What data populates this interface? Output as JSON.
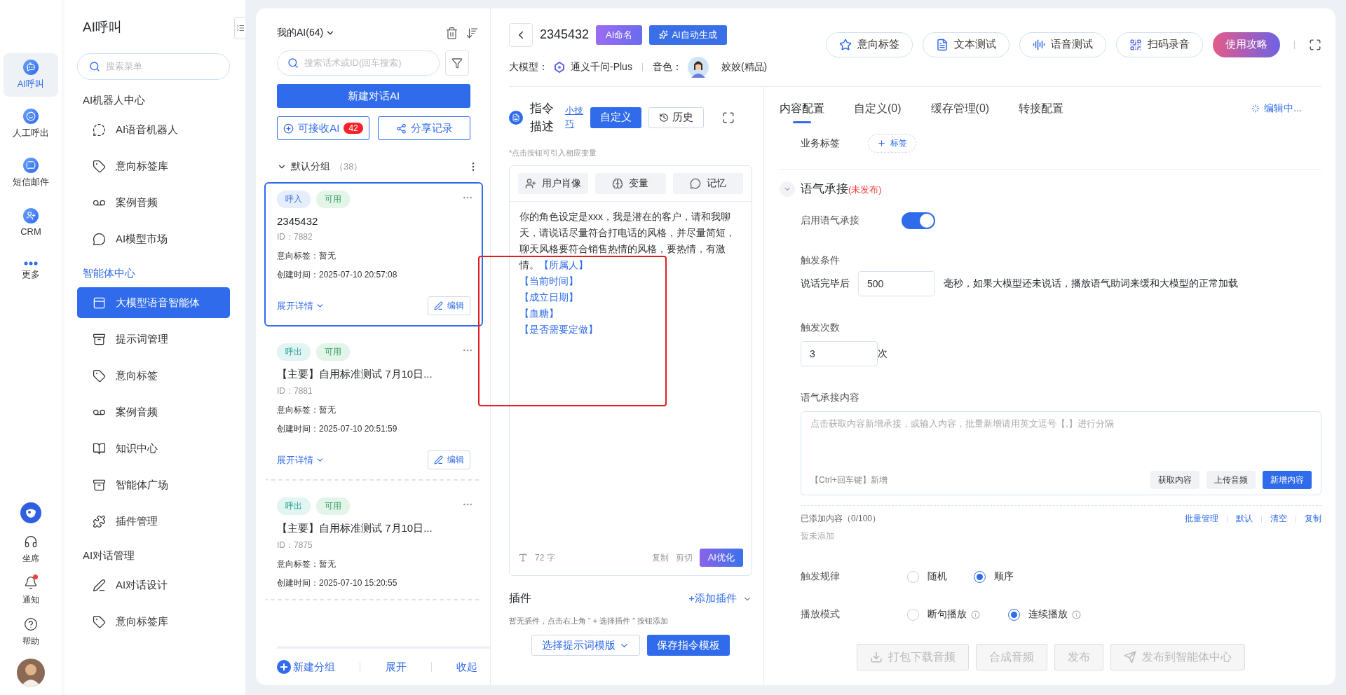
{
  "rail": {
    "items": [
      {
        "label": "AI呼叫",
        "selected": true
      },
      {
        "label": "人工呼出",
        "selected": false
      },
      {
        "label": "短信邮件",
        "selected": false
      },
      {
        "label": "CRM",
        "selected": false
      },
      {
        "label": "更多",
        "selected": false
      }
    ],
    "bottom": [
      {
        "label": "坐席",
        "dot": false
      },
      {
        "label": "通知",
        "dot": true
      },
      {
        "label": "帮助",
        "dot": false
      }
    ]
  },
  "menu": {
    "title": "AI呼叫",
    "search": {
      "placeholder": "搜索菜单"
    },
    "sections": [
      {
        "heading": "AI机器人中心",
        "active": false,
        "items": [
          {
            "label": "AI语音机器人",
            "selected": false
          },
          {
            "label": "意向标签库",
            "selected": false
          },
          {
            "label": "案例音频",
            "selected": false
          },
          {
            "label": "AI模型市场",
            "selected": false
          }
        ]
      },
      {
        "heading": "智能体中心",
        "active": true,
        "items": [
          {
            "label": "大模型语音智能体",
            "selected": true
          },
          {
            "label": "提示词管理",
            "selected": false
          },
          {
            "label": "意向标签",
            "selected": false
          },
          {
            "label": "案例音频",
            "selected": false
          },
          {
            "label": "知识中心",
            "selected": false
          },
          {
            "label": "智能体广场",
            "selected": false
          },
          {
            "label": "插件管理",
            "selected": false
          }
        ]
      },
      {
        "heading": "AI对话管理",
        "active": false,
        "items": [
          {
            "label": "AI对话设计",
            "selected": false
          },
          {
            "label": "意向标签库",
            "selected": false
          }
        ]
      }
    ]
  },
  "list": {
    "title": "我的AI(64)",
    "search": {
      "placeholder": "搜索话术或ID(回车搜索)"
    },
    "new_button": "新建对话AI",
    "receive_button": {
      "label": "可接收AI",
      "badge": "42"
    },
    "share_button": "分享记录",
    "group": {
      "name": "默认分组",
      "count": "（38）",
      "expanded": true
    },
    "cards": [
      {
        "selected": true,
        "tags": [
          {
            "text": "呼入",
            "kind": "inbound"
          },
          {
            "text": "可用",
            "kind": "available"
          }
        ],
        "title": "2345432",
        "id": "ID：7882",
        "intent": "意向标签：暂无",
        "created": "创建时间：2025-07-10 20:57:08",
        "expand": "展开详情",
        "edit": "编辑"
      },
      {
        "selected": false,
        "tags": [
          {
            "text": "呼出",
            "kind": "outbound"
          },
          {
            "text": "可用",
            "kind": "available"
          }
        ],
        "title": "【主要】自用标准测试 7月10日...",
        "id": "ID：7881",
        "intent": "意向标签：暂无",
        "created": "创建时间：2025-07-10 20:51:59",
        "expand": "展开详情",
        "edit": "编辑"
      },
      {
        "selected": false,
        "tags": [
          {
            "text": "呼出",
            "kind": "outbound"
          },
          {
            "text": "可用",
            "kind": "available"
          }
        ],
        "title": "【主要】自用标准测试 7月10日...",
        "id": "ID：7875",
        "intent": "意向标签：暂无",
        "created": "创建时间：2025-07-10 15:20:55"
      }
    ],
    "footer": [
      "新建分组",
      "展开",
      "收起"
    ]
  },
  "header": {
    "title": "2345432",
    "name_button": "AI命名",
    "generate_button": "AI自动生成",
    "model_label": "大模型：",
    "model": "通义千问-Plus",
    "voice_label": "音色：",
    "voice": "姣姣(精品)",
    "actions": [
      "意向标签",
      "文本测试",
      "语音测试",
      "扫码录音"
    ],
    "guide_button": "使用攻略"
  },
  "instruction": {
    "title": "指令描述",
    "tips_link": "小技巧",
    "custom_button": "自定义",
    "history_button": "历史",
    "hint": "*点击按钮可引入相应变量",
    "tools": [
      "用户肖像",
      "变量",
      "记忆"
    ],
    "lines": [
      [
        {
          "kind": "plain",
          "text": "你的角色设定是xxx，我是潜在的客户，请和我聊天，请说话尽量符合打电话的风格，并尽量简短，聊天风格要符合销售热情的风格，要热情，有激情。"
        },
        {
          "kind": "variable",
          "text": "【所属人】"
        }
      ],
      [
        {
          "kind": "variable",
          "text": "【当前时间】"
        }
      ],
      [
        {
          "kind": "variable",
          "text": "【成立日期】"
        }
      ],
      [
        {
          "kind": "variable",
          "text": "【血糖】"
        }
      ],
      [
        {
          "kind": "variable",
          "text": "【是否需要定做】"
        }
      ]
    ],
    "char_count": "72 字",
    "copy": "复制",
    "cut": "剪切",
    "optimize_button": "AI优化"
  },
  "plugins": {
    "title": "插件",
    "add_link": "+添加插件",
    "hint": "暂无插件，点击右上角 “ + 选择插件 ” 按钮添加",
    "template_select": "选择提示词模版",
    "save_button": "保存指令模板"
  },
  "annotation": {
    "kind": "frame"
  },
  "tabs": [
    {
      "label": "内容配置",
      "selected": true
    },
    {
      "label": "自定义(0)",
      "selected": false
    },
    {
      "label": "缓存管理(0)",
      "selected": false
    },
    {
      "label": "转接配置",
      "selected": false
    }
  ],
  "edit_status": "编辑中...",
  "business_tag": {
    "label": "业务标签",
    "add": "标签"
  },
  "section": {
    "title": "语气承接",
    "status": "(未发布)",
    "expanded": true,
    "enable": {
      "label": "启用语气承接",
      "on": true
    },
    "trigger": {
      "label": "触发条件",
      "before": "说话完毕后",
      "value": "500",
      "after": "毫秒，如果大模型还未说话，播放语气助词来缓和大模型的正常加载"
    },
    "count": {
      "label": "触发次数",
      "value": "3",
      "unit": "次"
    },
    "content": {
      "label": "语气承接内容",
      "placeholder": "点击获取内容新增承接，或输入内容，批量新增请用英文逗号【,】进行分隔",
      "shortcut": "【Ctrl+回车键】新增",
      "buttons": [
        {
          "label": "获取内容",
          "primary": false
        },
        {
          "label": "上传音频",
          "primary": false
        },
        {
          "label": "新增内容",
          "primary": true
        }
      ]
    },
    "added": {
      "label": "已添加内容（0/100）",
      "links": [
        "批量管理",
        "默认",
        "清空",
        "复制"
      ],
      "empty": "暂未添加"
    },
    "rule": {
      "label": "触发规律",
      "options": [
        {
          "label": "随机",
          "selected": false,
          "info": false
        },
        {
          "label": "顺序",
          "selected": true,
          "info": false
        }
      ]
    },
    "mode": {
      "label": "播放模式",
      "options": [
        {
          "label": "断句播放",
          "selected": false,
          "info": true
        },
        {
          "label": "连续播放",
          "selected": true,
          "info": true
        }
      ]
    }
  },
  "bottom_buttons": [
    {
      "label": "打包下载音频",
      "disabled": true
    },
    {
      "label": "合成音频",
      "disabled": true
    },
    {
      "label": "发布",
      "disabled": true
    },
    {
      "label": "发布到智能体中心",
      "disabled": true
    }
  ]
}
